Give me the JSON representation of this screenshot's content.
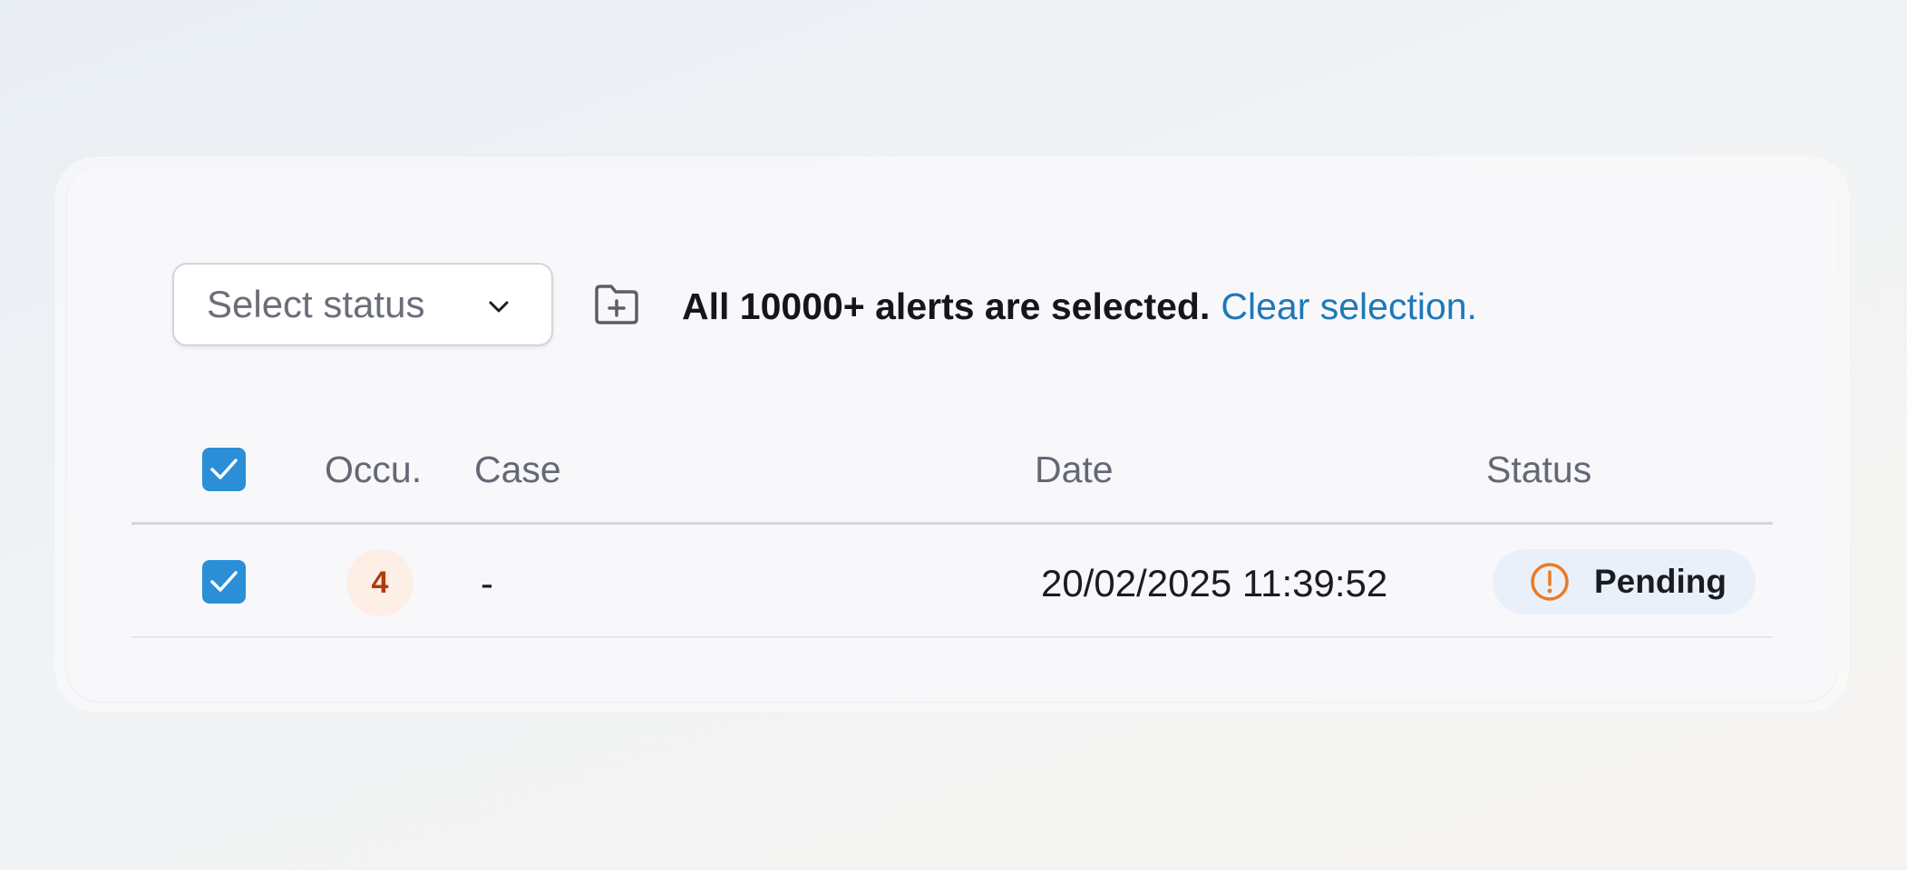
{
  "toolbar": {
    "status_placeholder": "Select status",
    "selection_message": "All 10000+ alerts are selected.",
    "clear_selection_label": "Clear selection."
  },
  "table": {
    "columns": [
      "Occu.",
      "Case",
      "Date",
      "Status"
    ],
    "select_all_checked": true,
    "rows": [
      {
        "selected": true,
        "occurrences": "4",
        "case": "-",
        "date": "20/02/2025 11:39:52",
        "status": "Pending"
      }
    ]
  },
  "icons": {
    "dropdown": "chevron-down-icon",
    "folder": "folder-plus-icon",
    "checkbox": "check-icon",
    "status": "alert-circle-icon"
  },
  "colors": {
    "accent": "#2a8fd6",
    "link": "#1d78b8",
    "occurrence_badge_bg": "#fdeee6",
    "occurrence_badge_text": "#b23a0c",
    "pending_icon": "#ee7a22",
    "status_pill_bg": "#eaf0f9"
  }
}
